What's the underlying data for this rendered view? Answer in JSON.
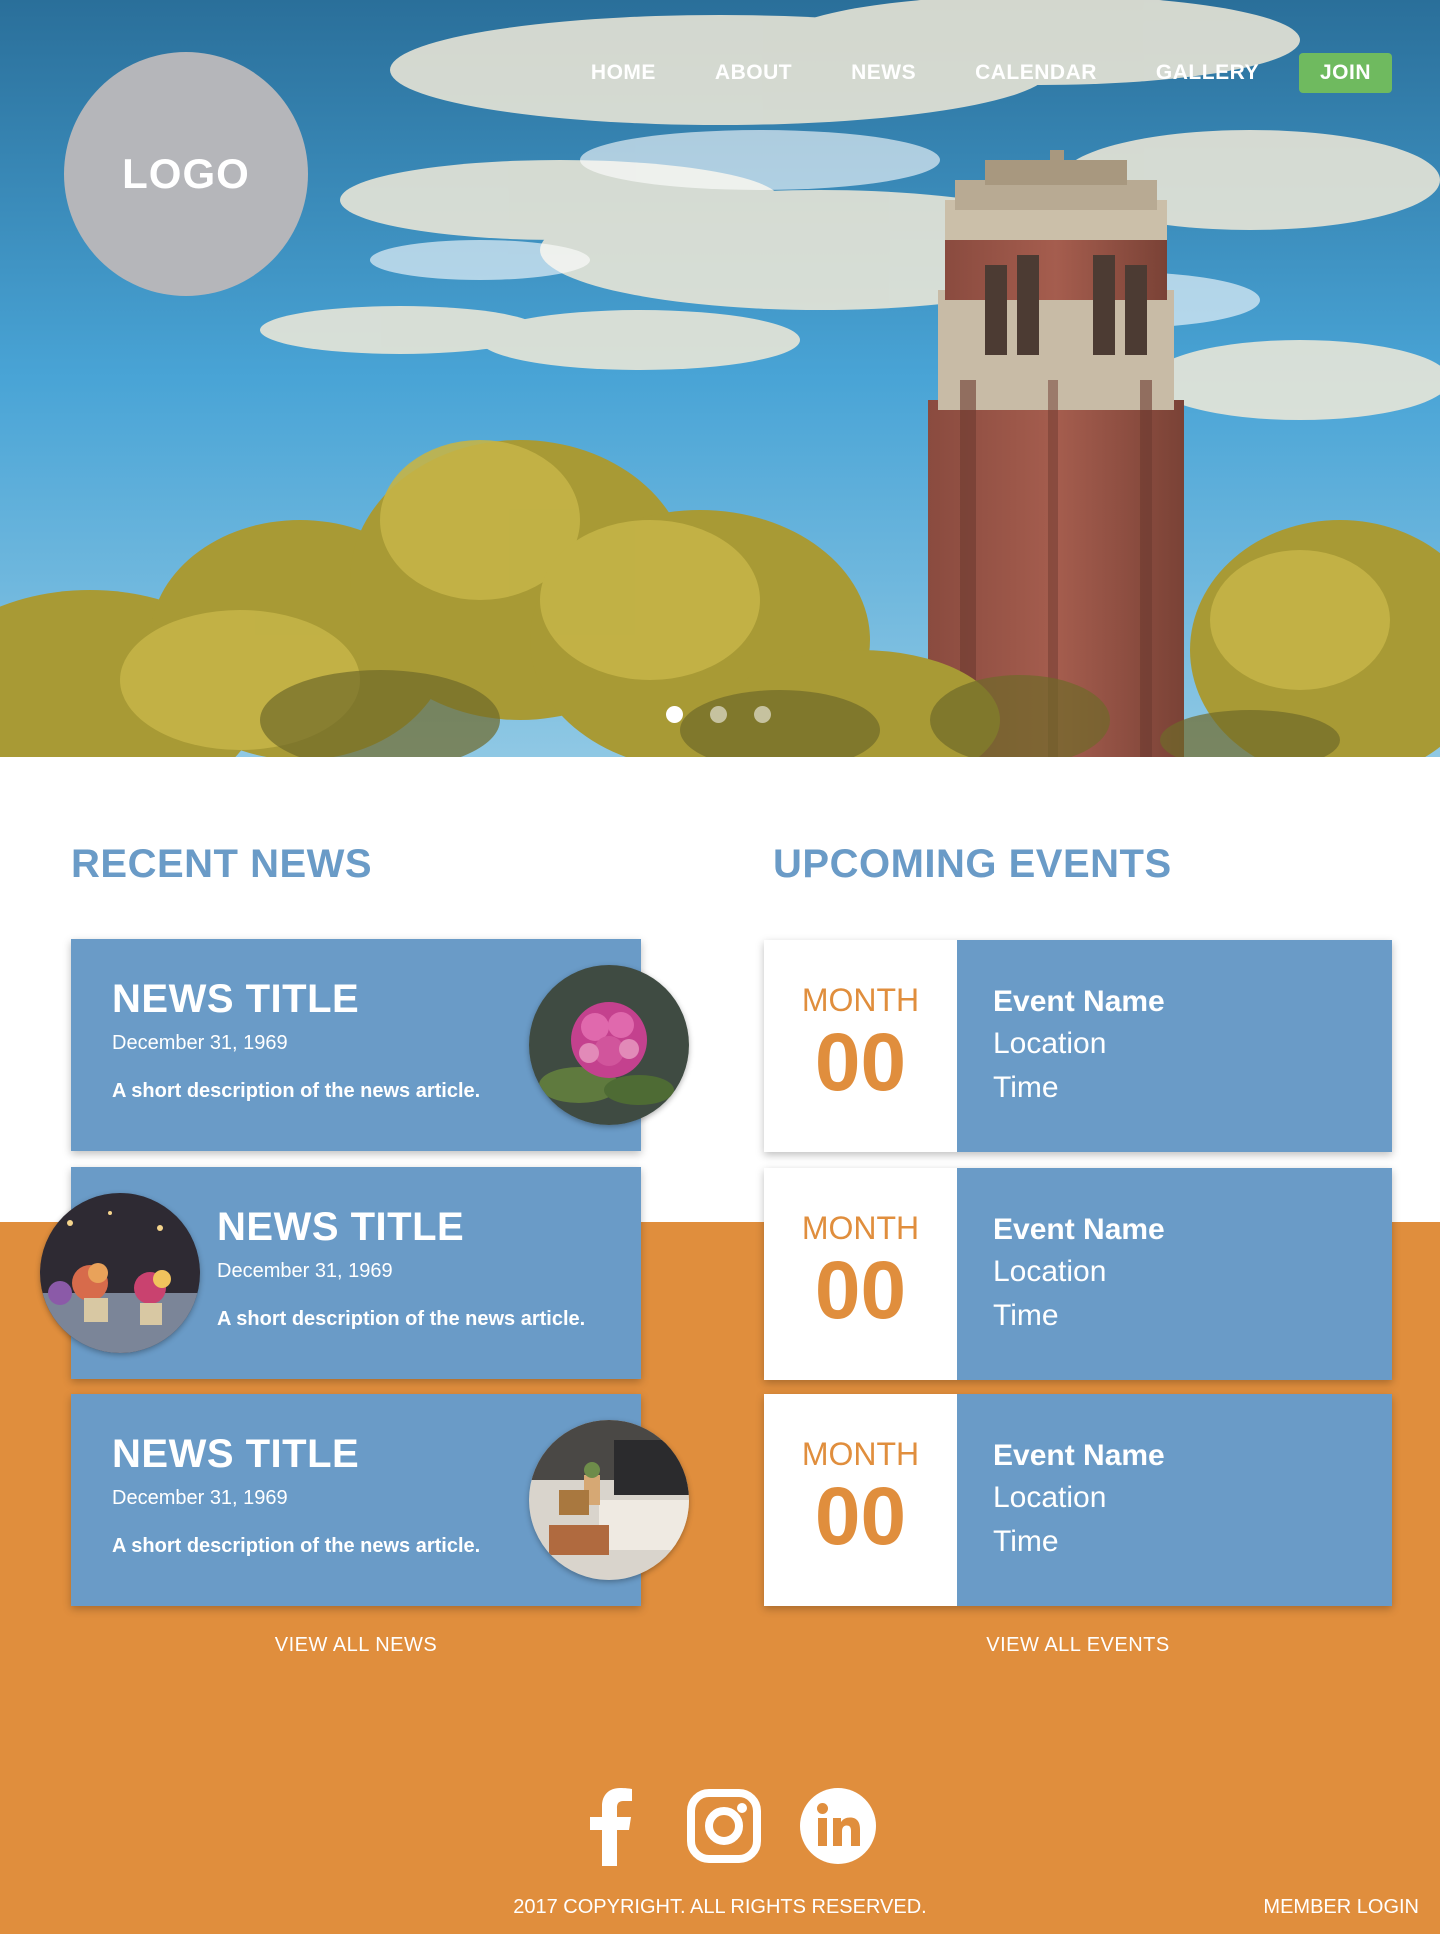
{
  "brand": {
    "logo_text": "LOGO"
  },
  "nav": {
    "items": [
      {
        "label": "HOME"
      },
      {
        "label": "ABOUT"
      },
      {
        "label": "NEWS"
      },
      {
        "label": "CALENDAR"
      },
      {
        "label": "GALLERY"
      }
    ],
    "join_label": "JOIN"
  },
  "carousel": {
    "slide_count": 3,
    "active_index": 0
  },
  "news": {
    "heading": "RECENT NEWS",
    "items": [
      {
        "title": "NEWS TITLE",
        "date": "December 31, 1969",
        "description": "A short description of the news article."
      },
      {
        "title": "NEWS TITLE",
        "date": "December 31, 1969",
        "description": "A short description of the news article."
      },
      {
        "title": "NEWS TITLE",
        "date": "December 31, 1969",
        "description": "A short description of the news article."
      }
    ],
    "view_all_label": "VIEW ALL NEWS"
  },
  "events": {
    "heading": "UPCOMING EVENTS",
    "items": [
      {
        "month": "MONTH",
        "day": "00",
        "name": "Event Name",
        "location": "Location",
        "time": "Time"
      },
      {
        "month": "MONTH",
        "day": "00",
        "name": "Event Name",
        "location": "Location",
        "time": "Time"
      },
      {
        "month": "MONTH",
        "day": "00",
        "name": "Event Name",
        "location": "Location",
        "time": "Time"
      }
    ],
    "view_all_label": "VIEW ALL EVENTS"
  },
  "social": {
    "icons": [
      "facebook-icon",
      "instagram-icon",
      "linkedin-icon"
    ]
  },
  "footer": {
    "copyright": "2017 COPYRIGHT. ALL RIGHTS RESERVED.",
    "member_login": "MEMBER LOGIN"
  },
  "colors": {
    "blue": "#6a9bc7",
    "orange": "#e08e3d",
    "join_green": "#6fba5f",
    "logo_gray": "#b5b6ba"
  }
}
